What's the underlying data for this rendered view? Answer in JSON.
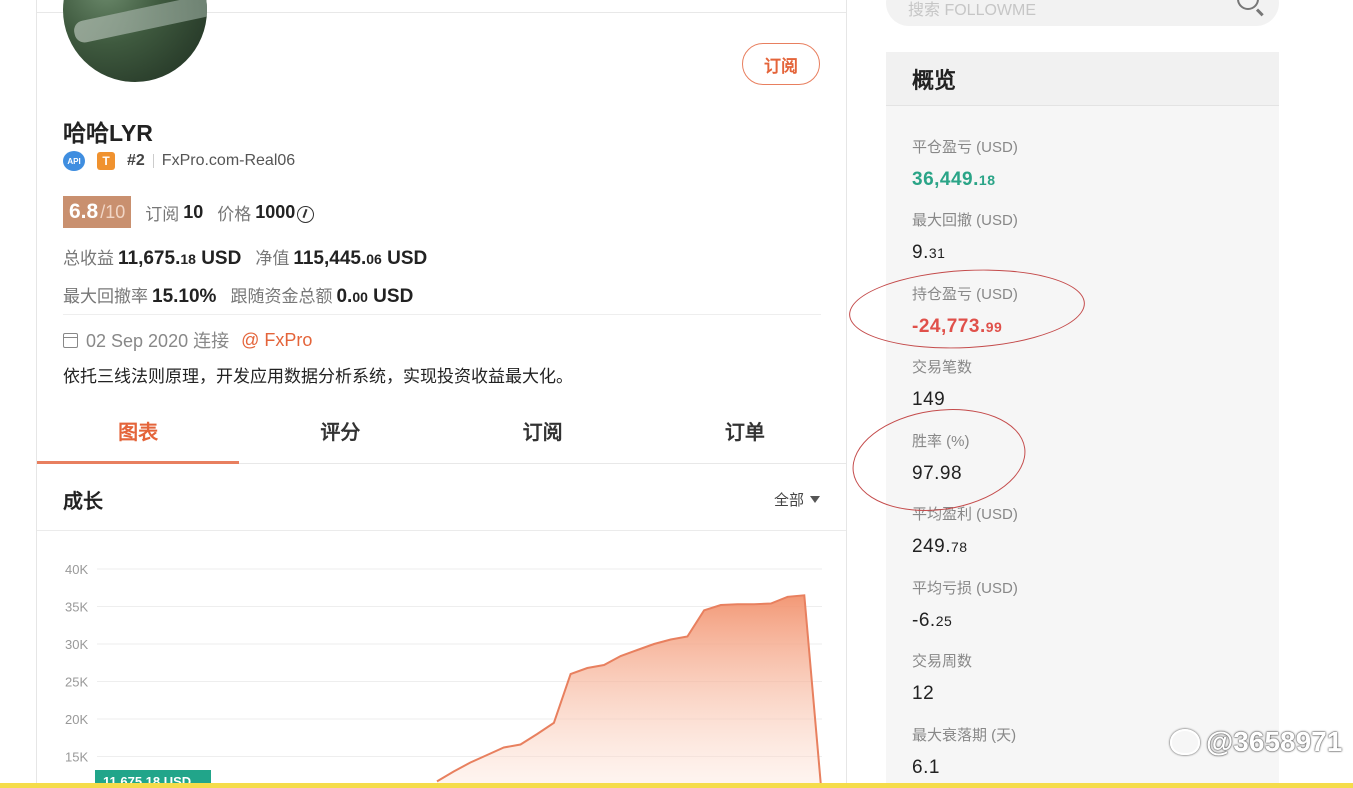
{
  "profile": {
    "name": "哈哈LYR",
    "subscribe_label": "订阅",
    "badge_api": "API",
    "badge_t": "T",
    "rank": "#2",
    "broker_account": "FxPro.com-Real06",
    "score": "6.8",
    "score_max": "/10",
    "subscriptions_label": "订阅",
    "subscriptions_value": "10",
    "price_label": "价格",
    "price_value": "1000",
    "total_profit_label": "总收益",
    "total_profit_int": "11,675.",
    "total_profit_dec": "18",
    "total_profit_unit": "USD",
    "equity_label": "净值",
    "equity_int": "115,445.",
    "equity_dec": "06",
    "equity_unit": "USD",
    "max_drawdown_label": "最大回撤率",
    "max_drawdown_value": "15.10%",
    "follow_funds_label": "跟随资金总额",
    "follow_funds_int": "0.",
    "follow_funds_dec": "00",
    "follow_funds_unit": "USD",
    "connected_date": "02 Sep 2020 连接",
    "broker_link": "@ FxPro",
    "description": "依托三线法则原理，开发应用数据分析系统，实现投资收益最大化。"
  },
  "tabs": [
    {
      "label": "图表",
      "active": true
    },
    {
      "label": "评分",
      "active": false
    },
    {
      "label": "订阅",
      "active": false
    },
    {
      "label": "订单",
      "active": false
    }
  ],
  "growth": {
    "title": "成长",
    "range_label": "全部"
  },
  "chart_data": {
    "type": "area",
    "y_ticks": [
      "40K",
      "35K",
      "30K",
      "25K",
      "20K",
      "15K"
    ],
    "ylim": [
      0,
      40000
    ],
    "series": [
      {
        "values": [
          11675,
          13000,
          14200,
          15200,
          16200,
          16600,
          18000,
          19500,
          26000,
          26800,
          27200,
          28400,
          29200,
          30000,
          30600,
          31000,
          34500,
          35200,
          35300,
          35300,
          35400,
          36300,
          36500,
          11000
        ]
      }
    ],
    "badge_value": "11,675.18 USD",
    "color": "#e8805f"
  },
  "search": {
    "placeholder": "搜索 FOLLOWME"
  },
  "overview": {
    "title": "概览",
    "items": [
      {
        "label": "平仓盈亏 (USD)",
        "int": "36,449.",
        "dec": "18",
        "tone": "pos"
      },
      {
        "label": "最大回撤 (USD)",
        "int": "9.",
        "dec": "31",
        "tone": ""
      },
      {
        "label": "持仓盈亏 (USD)",
        "int": "-24,773.",
        "dec": "99",
        "tone": "neg"
      },
      {
        "label": "交易笔数",
        "int": "149",
        "dec": "",
        "tone": ""
      },
      {
        "label": "胜率 (%)",
        "int": "97.98",
        "dec": "",
        "tone": ""
      },
      {
        "label": "平均盈利 (USD)",
        "int": "249.",
        "dec": "78",
        "tone": ""
      },
      {
        "label": "平均亏损 (USD)",
        "int": "-6.",
        "dec": "25",
        "tone": ""
      },
      {
        "label": "交易周数",
        "int": "12",
        "dec": "",
        "tone": ""
      },
      {
        "label": "最大衰落期 (天)",
        "int": "6.1",
        "dec": "",
        "tone": ""
      }
    ]
  },
  "watermark": "@3658971",
  "colors": {
    "accent": "#e4643a",
    "positive": "#2aa487",
    "negative": "#e0504a",
    "score_bg": "#c9906f"
  }
}
